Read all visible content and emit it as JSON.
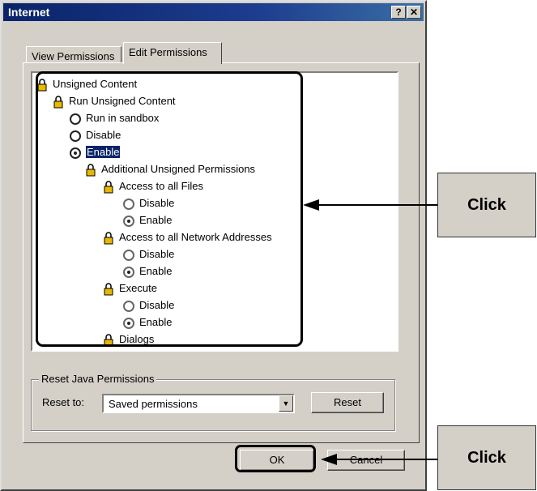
{
  "window": {
    "title": "Internet",
    "help_label": "?",
    "close_label": "✕"
  },
  "tabs": [
    {
      "label": "View Permissions"
    },
    {
      "label": "Edit Permissions"
    }
  ],
  "tree": {
    "items": [
      {
        "label": "Unsigned Content",
        "icon": "lock-icon"
      },
      {
        "label": "Run Unsigned Content",
        "icon": "lock-icon"
      },
      {
        "label": "Run in sandbox",
        "icon": "radio-empty"
      },
      {
        "label": "Disable",
        "icon": "radio-empty"
      },
      {
        "label": "Enable",
        "icon": "radio-selected",
        "selected": true
      },
      {
        "label": "Additional Unsigned Permissions",
        "icon": "lock-icon"
      },
      {
        "label": "Access to all Files",
        "icon": "lock-icon"
      },
      {
        "label": "Disable",
        "icon": "radio-empty"
      },
      {
        "label": "Enable",
        "icon": "radio-selected"
      },
      {
        "label": "Access to all Network Addresses",
        "icon": "lock-icon"
      },
      {
        "label": "Disable",
        "icon": "radio-empty"
      },
      {
        "label": "Enable",
        "icon": "radio-selected"
      },
      {
        "label": "Execute",
        "icon": "lock-icon"
      },
      {
        "label": "Disable",
        "icon": "radio-empty"
      },
      {
        "label": "Enable",
        "icon": "radio-selected"
      },
      {
        "label": "Dialogs",
        "icon": "lock-icon"
      }
    ]
  },
  "reset_group": {
    "title": "Reset Java Permissions",
    "reset_to_label": "Reset to:",
    "reset_to_value": "Saved permissions",
    "reset_button": "Reset"
  },
  "buttons": {
    "ok": "OK",
    "cancel": "Cancel"
  },
  "callouts": {
    "top": "Click",
    "bottom": "Click"
  },
  "colors": {
    "dialog_bg": "#d4d0c8",
    "title_bar": "#0a246a",
    "selection": "#0a246a",
    "lock_icon": "#e8b800"
  }
}
